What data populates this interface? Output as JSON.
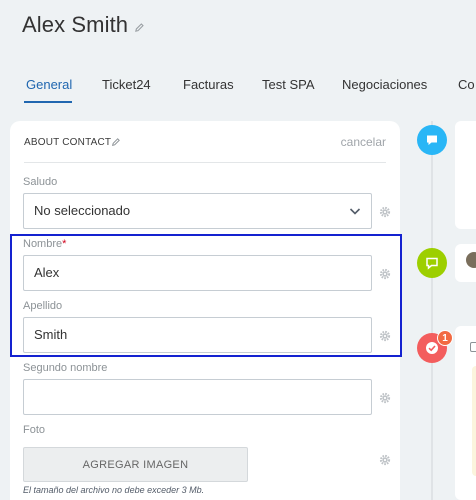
{
  "header": {
    "title": "Alex Smith"
  },
  "tabs": [
    {
      "label": "General",
      "active": true
    },
    {
      "label": "Ticket24"
    },
    {
      "label": "Facturas"
    },
    {
      "label": "Test SPA"
    },
    {
      "label": "Negociaciones"
    },
    {
      "label": "Co"
    }
  ],
  "section": {
    "title": "ABOUT CONTACT",
    "cancel_label": "cancelar"
  },
  "fields": {
    "salutation": {
      "label": "Saludo",
      "value": "No seleccionado"
    },
    "first_name": {
      "label": "Nombre",
      "required_mark": "*",
      "value": "Alex"
    },
    "last_name": {
      "label": "Apellido",
      "value": "Smith"
    },
    "middle_name": {
      "label": "Segundo nombre",
      "value": ""
    },
    "photo": {
      "label": "Foto",
      "button_label": "AGREGAR IMAGEN",
      "note": "El tamaño del archivo no debe exceder 3 Mb."
    }
  },
  "timeline": {
    "badge_count": "1"
  },
  "colors": {
    "accent": "#2067b0",
    "highlight": "#1422d0",
    "timeline_blue": "#29b6f6",
    "timeline_green": "#9dcf00",
    "timeline_red": "#f35d5d"
  },
  "icons": {
    "title_edit": "pencil-icon",
    "section_edit": "pencil-icon",
    "select": "chevron-down-icon",
    "field_settings": "gear-icon",
    "timeline_1": "chat-bubble-icon",
    "timeline_2": "comment-icon",
    "timeline_3": "check-icon"
  }
}
